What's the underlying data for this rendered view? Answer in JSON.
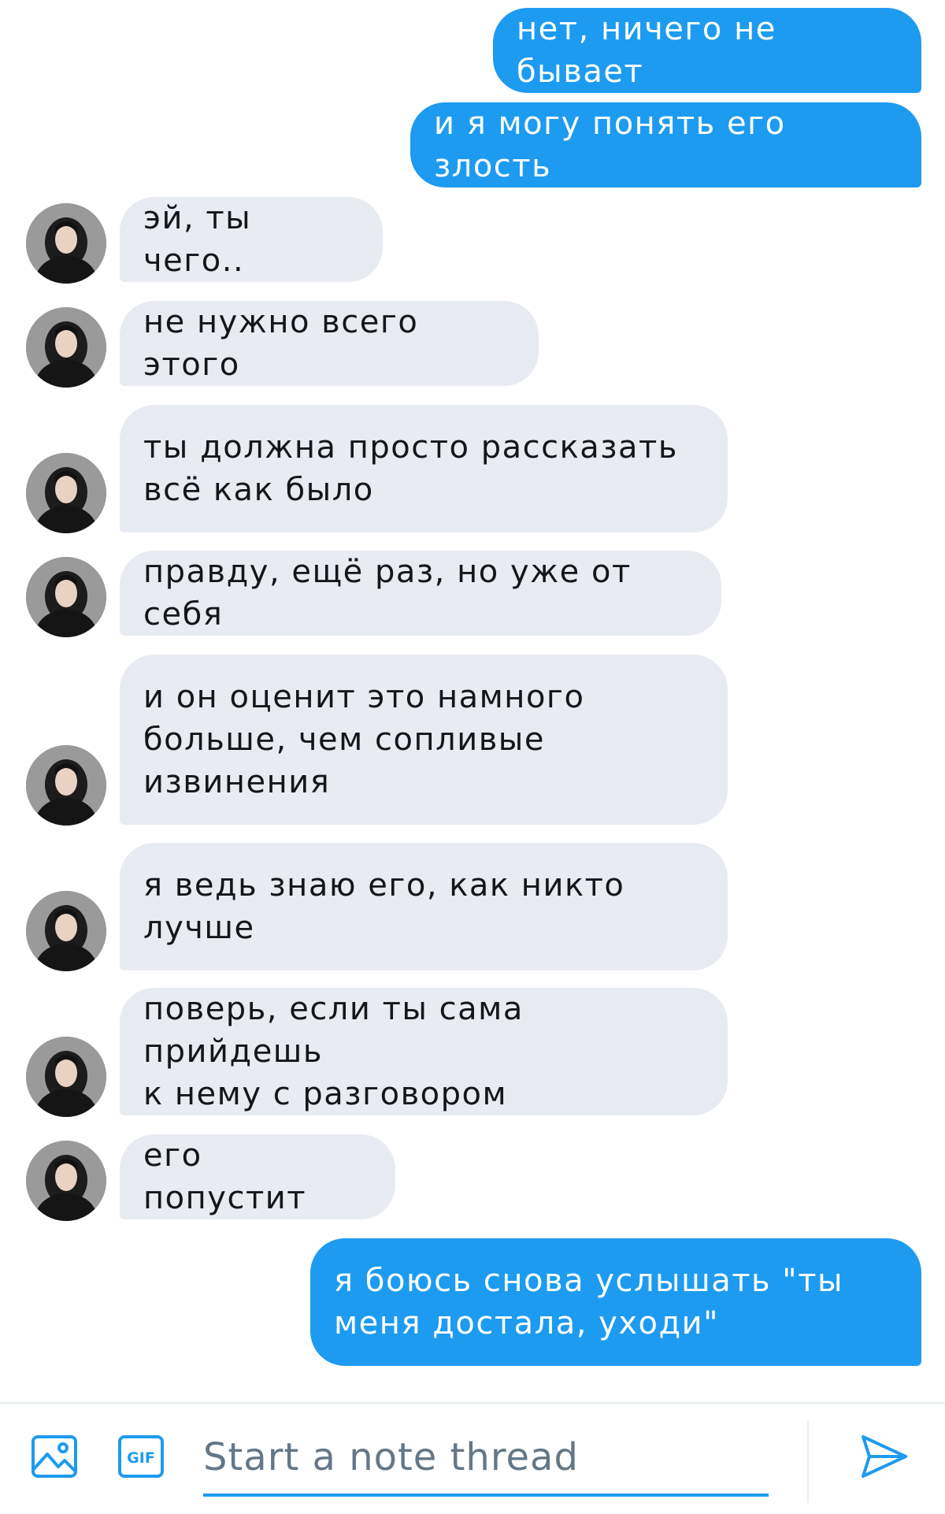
{
  "colors": {
    "accent": "#1d9bf0",
    "incoming_bubble": "#e8ebf2",
    "outgoing_text": "#ffffff",
    "incoming_text": "#14171a"
  },
  "messages": [
    {
      "direction": "out",
      "text": "нет, ничего не бывает"
    },
    {
      "direction": "out",
      "text": "и я могу понять его злость"
    },
    {
      "direction": "in",
      "text": "эй, ты чего.."
    },
    {
      "direction": "in",
      "text": "не нужно всего этого"
    },
    {
      "direction": "in",
      "text": "ты должна просто рассказать\nвсё как было"
    },
    {
      "direction": "in",
      "text": "правду, ещё раз, но уже от себя"
    },
    {
      "direction": "in",
      "text": "и он оценит это намного\nбольше, чем сопливые\nизвинения"
    },
    {
      "direction": "in",
      "text": "я ведь знаю его, как никто\nлучше"
    },
    {
      "direction": "in",
      "text": "поверь, если ты сама прийдешь\nк нему с разговором"
    },
    {
      "direction": "in",
      "text": "его попустит"
    },
    {
      "direction": "out",
      "text": "я боюсь снова услышать \"ты\nменя достала, уходи\""
    }
  ],
  "composer": {
    "placeholder": "Start a note thread",
    "icons": {
      "media": "image-icon",
      "gif": "gif-icon",
      "send": "send-icon"
    },
    "gif_label": "GIF"
  }
}
